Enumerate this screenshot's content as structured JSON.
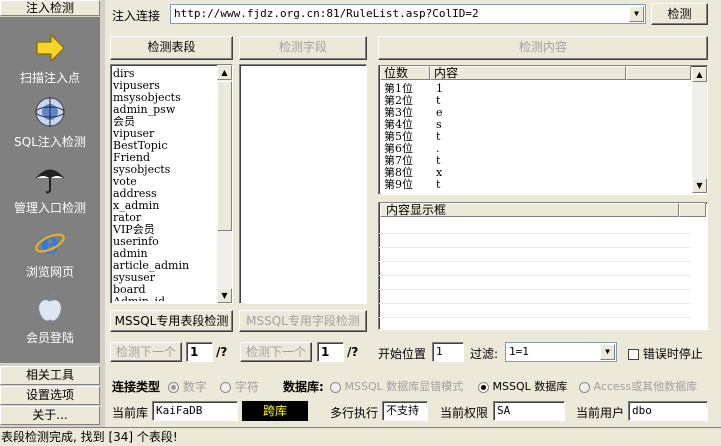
{
  "sidebar": {
    "header": "注入检测",
    "items": [
      {
        "label": "扫描注入点",
        "icon": "arrow-right-icon"
      },
      {
        "label": "SQL注入检测",
        "icon": "globe-icon"
      },
      {
        "label": "管理入口检测",
        "icon": "umbrella-icon"
      },
      {
        "label": "浏览网页",
        "icon": "ie-icon"
      },
      {
        "label": "会员登陆",
        "icon": "apple-icon"
      }
    ],
    "bottom_buttons": [
      "相关工具",
      "设置选项",
      "关于..."
    ]
  },
  "top": {
    "url_label": "注入连接",
    "url_value": "http://www.fjdz.org.cn:81/RuleList.asp?ColID=2",
    "detect_button": "检测"
  },
  "tables_panel": {
    "header": "检测表段",
    "items": [
      "dirs",
      "vipusers",
      "msysobjects",
      "admin_psw",
      "会员",
      "vipuser",
      "BestTopic",
      "Friend",
      "sysobjects",
      "vote",
      "address",
      "x_admin",
      "rator",
      "VIP会员",
      "userinfo",
      "admin",
      "article_admin",
      "sysuser",
      "board",
      "Admin_id"
    ],
    "mssql_button": "MSSQL专用表段检测",
    "next_button": "检测下一个",
    "page_value": "1",
    "page_total": "/?"
  },
  "fields_panel": {
    "header": "检测字段",
    "mssql_button": "MSSQL专用字段检测",
    "next_button": "检测下一个",
    "page_value": "1",
    "page_total": "/?"
  },
  "content_panel": {
    "header": "检测内容",
    "columns": [
      "位数",
      "内容"
    ],
    "rows": [
      [
        "第1位",
        "1"
      ],
      [
        "第2位",
        "t"
      ],
      [
        "第3位",
        "e"
      ],
      [
        "第4位",
        "s"
      ],
      [
        "第5位",
        "t"
      ],
      [
        "第6位",
        "."
      ],
      [
        "第7位",
        "t"
      ],
      [
        "第8位",
        "x"
      ],
      [
        "第9位",
        "t"
      ]
    ],
    "display_header": "内容显示框"
  },
  "options": {
    "start_label": "开始位置",
    "start_value": "1",
    "filter_label": "过滤:",
    "filter_value": "1=1",
    "stop_on_error_label": "错误时停止"
  },
  "connection": {
    "type_label": "连接类型",
    "type_options": [
      "数字",
      "字符"
    ],
    "db_label": "数据库:",
    "db_options": [
      "MSSQL 数据库显错模式",
      "MSSQL 数据库",
      "Access或其他数据库"
    ],
    "db_selected_index": 1
  },
  "info": {
    "current_db_label": "当前库",
    "current_db_value": "KaiFaDB",
    "cross_db_button": "跨库",
    "multi_exec_label": "多行执行",
    "multi_exec_value": "不支持",
    "perm_label": "当前权限",
    "perm_value": "SA",
    "user_label": "当前用户",
    "user_value": "dbo"
  },
  "status": {
    "text": "表段检测完成, 找到 [34] 个表段!"
  }
}
